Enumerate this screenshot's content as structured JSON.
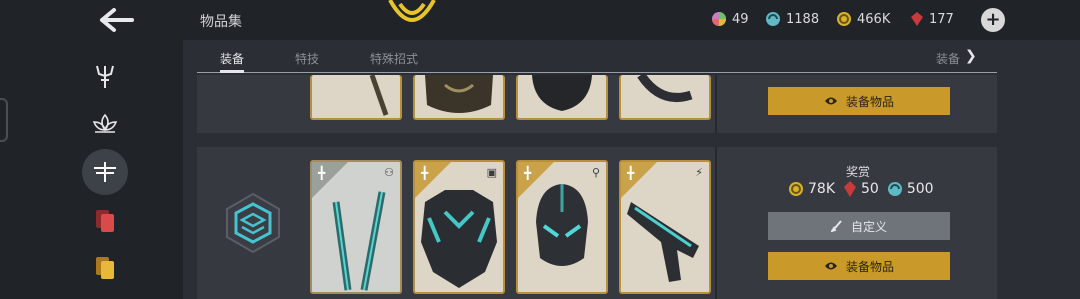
{
  "header": {
    "title": "物品集",
    "currencies": [
      {
        "name": "multi-gem",
        "value": "49"
      },
      {
        "name": "cyan-orb",
        "value": "1188"
      },
      {
        "name": "gold-coin",
        "value": "466K"
      },
      {
        "name": "ruby",
        "value": "177"
      }
    ]
  },
  "tabs": [
    {
      "label": "装备",
      "active": true
    },
    {
      "label": "特技",
      "active": false
    },
    {
      "label": "特殊招式",
      "active": false
    }
  ],
  "tab_more": "装备",
  "rows": [
    {
      "equip_label": "装备物品"
    },
    {
      "reward_title": "奖赏",
      "rewards": [
        {
          "icon": "gold-coin-icon",
          "value": "78K"
        },
        {
          "icon": "ruby-icon",
          "value": "50"
        },
        {
          "icon": "cyan-orb-icon",
          "value": "500"
        }
      ],
      "customize_label": "自定义",
      "equip_label": "装备物品"
    }
  ],
  "colors": {
    "accent_gold": "#c99a2a",
    "background": "#23262b",
    "panel": "#363940"
  }
}
